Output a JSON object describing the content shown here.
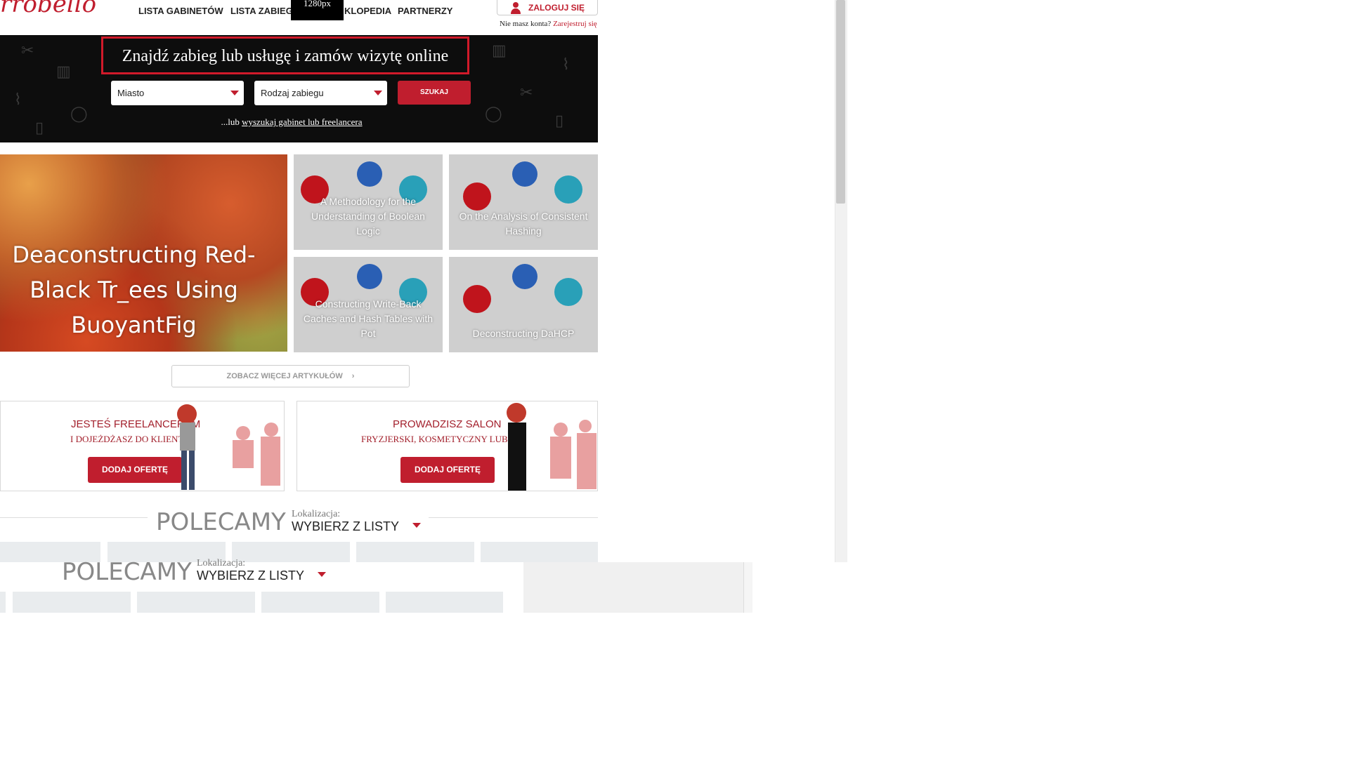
{
  "header": {
    "logo_text": "rrobello",
    "nav": [
      "LISTA GABINETÓW",
      "LISTA ZABIEGÓW",
      "ENCYKLOPEDIA",
      "PARTNERZY"
    ],
    "nav_visible": [
      "LISTA GABINETÓW",
      "LISTA ZABIEGÓ",
      "KLOPEDIA",
      "PARTNERZY"
    ],
    "tooltip": "1280px",
    "login_label": "ZALOGUJ SIĘ",
    "no_account": "Nie masz konta?",
    "register_link": "Zarejestruj się"
  },
  "hero": {
    "title": "Znajdź zabieg lub usługę i zamów wizytę online",
    "city_select": "Miasto",
    "treatment_select": "Rodzaj zabiegu",
    "search_label": "SZUKAJ",
    "alt_prefix": "...lub ",
    "alt_link": "wyszukaj gabinet lub freelancera"
  },
  "articles": {
    "featured": "Deaconstructing Red-Black Tr_ees Using BuoyantFig",
    "tiles": [
      "A Methodology for the Understanding of Boolean Logic",
      "On the Analysis of Consistent Hashing",
      "Constructing Write-Back Caches and Hash Tables with Pot",
      "Deconstructing DaHCP"
    ],
    "more_label": "ZOBACZ WIĘCEJ ARTYKUŁÓW"
  },
  "promo": {
    "freelancer": {
      "heading": "JESTEŚ FREELANCEREM",
      "sub": "I DOJEŻDŻASZ DO KLIENTA",
      "button": "DODAJ OFERTĘ"
    },
    "salon": {
      "heading": "PROWADZISZ SALON",
      "sub": "FRYZJERSKI, KOSMETYCZNY LUB SPA",
      "button": "DODAJ OFERTĘ"
    }
  },
  "recommended": {
    "heading": "POLECAMY",
    "location_label": "Lokalizacja:",
    "location_value": "WYBIERZ Z LISTY"
  },
  "colors": {
    "accent": "#c01e2e",
    "hero_bg": "#0d0d0d"
  }
}
